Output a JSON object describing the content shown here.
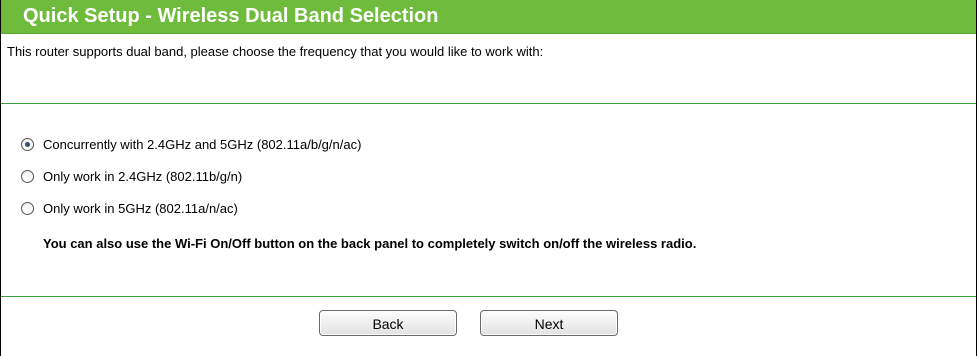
{
  "header": {
    "title": "Quick Setup - Wireless Dual Band Selection"
  },
  "intro_text": "This router supports dual band, please choose the frequency that you would like to work with:",
  "band_options": [
    {
      "label": "Concurrently with 2.4GHz and 5GHz (802.11a/b/g/n/ac)",
      "selected": true
    },
    {
      "label": "Only work in 2.4GHz (802.11b/g/n)",
      "selected": false
    },
    {
      "label": "Only work in 5GHz (802.11a/n/ac)",
      "selected": false
    }
  ],
  "note": "You can also use the Wi-Fi On/Off button on the back panel to completely switch on/off the wireless radio.",
  "buttons": {
    "back_label": "Back",
    "next_label": "Next"
  },
  "colors": {
    "header_green": "#6fbb3c",
    "rule_green": "#3d9f3a"
  }
}
